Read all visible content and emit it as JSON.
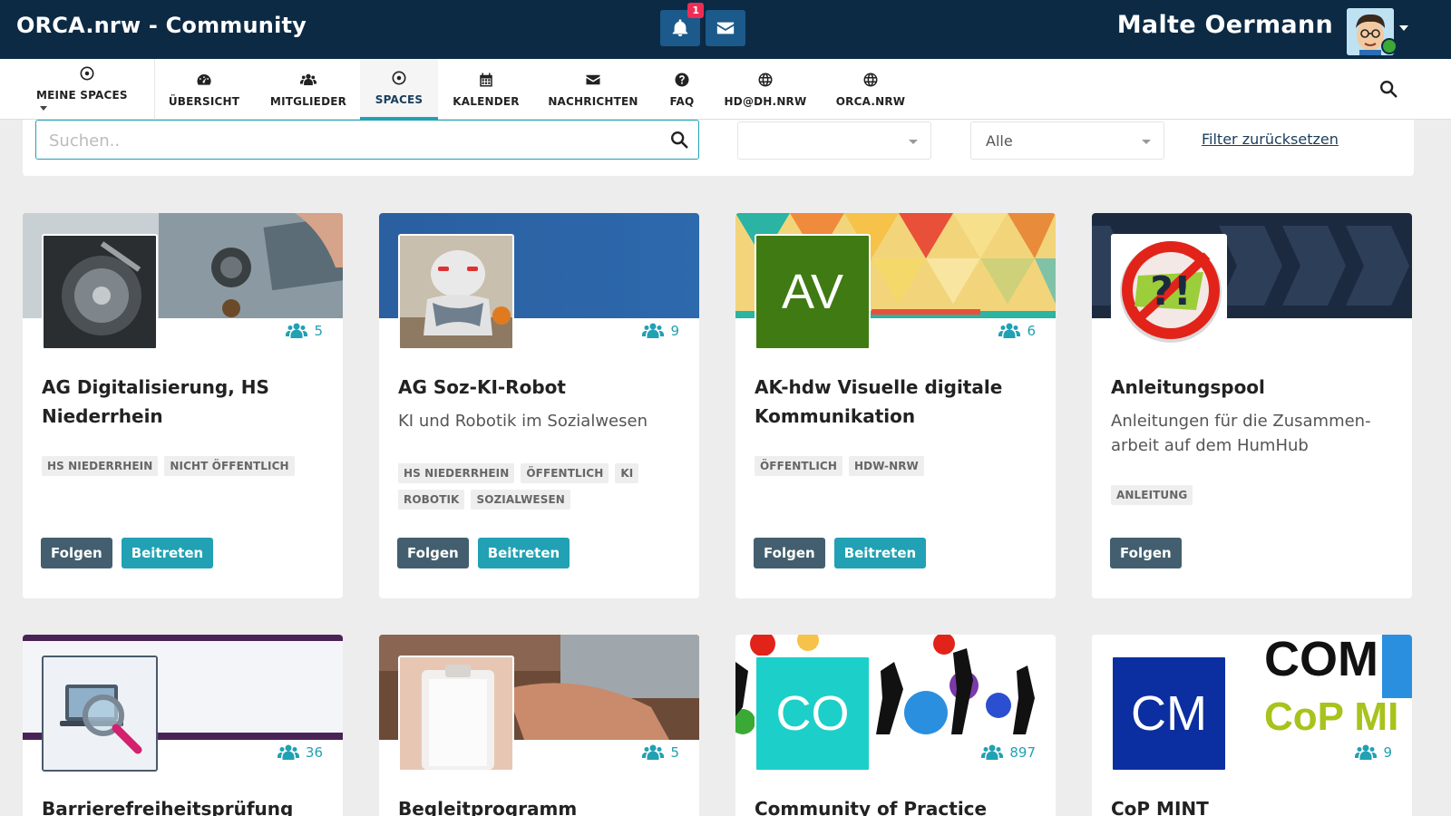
{
  "header": {
    "brand": "ORCA.nrw - Community",
    "notifications_count": "1",
    "username": "Malte Oermann"
  },
  "nav": {
    "items": [
      {
        "label": "MEINE SPACES",
        "icon": "target-icon"
      },
      {
        "label": "ÜBERSICHT",
        "icon": "dashboard-icon"
      },
      {
        "label": "MITGLIEDER",
        "icon": "users-icon"
      },
      {
        "label": "SPACES",
        "icon": "target-icon"
      },
      {
        "label": "KALENDER",
        "icon": "calendar-icon"
      },
      {
        "label": "NACHRICHTEN",
        "icon": "envelope-icon"
      },
      {
        "label": "FAQ",
        "icon": "question-icon"
      },
      {
        "label": "HD@DH.NRW",
        "icon": "globe-icon"
      },
      {
        "label": "ORCA.NRW",
        "icon": "globe-icon"
      }
    ],
    "active": "SPACES"
  },
  "filters": {
    "search_placeholder": "Suchen..",
    "select1_value": "",
    "select2_value": "Alle",
    "reset_label": "Filter zurücksetzen"
  },
  "cards": [
    {
      "title": "AG Digitalisierung, HS Niederrhein",
      "description": "",
      "members": "5",
      "tags": [
        "HS NIEDERRHEIN",
        "NICHT ÖFFENTLICH"
      ],
      "follow_label": "Folgen",
      "join_label": "Beitreten"
    },
    {
      "title": "AG Soz-KI-Robot",
      "description": "KI und Robotik im Sozialwesen",
      "members": "9",
      "tags": [
        "HS NIEDERRHEIN",
        "ÖFFENTLICH",
        "KI",
        "ROBOTIK",
        "SOZIALWESEN"
      ],
      "follow_label": "Folgen",
      "join_label": "Beitreten"
    },
    {
      "title": "AK-hdw Visuelle digitale Kommunikation",
      "description": "",
      "members": "6",
      "thumb_text": "AV",
      "thumb_color": "#3f7a12",
      "tags": [
        "ÖFFENTLICH",
        "HDW-NRW"
      ],
      "follow_label": "Folgen",
      "join_label": "Beitreten"
    },
    {
      "title": "Anleitungspool",
      "description": "Anleitungen für die Zusammen-arbeit auf dem HumHub",
      "members": "",
      "thumb_text": "?!",
      "tags": [
        "ANLEITUNG"
      ],
      "follow_label": "Folgen"
    },
    {
      "title": "Barrierefreiheitsprüfung",
      "members": "36"
    },
    {
      "title": "Begleitprogramm",
      "members": "5"
    },
    {
      "title": "Community of Practice",
      "members": "897",
      "thumb_text": "CO",
      "thumb_color": "#1ccfc9"
    },
    {
      "title": "CoP MINT",
      "members": "9",
      "thumb_text": "CM",
      "thumb_color": "#0b2fa0",
      "banner_text_1": "COM",
      "banner_text_2": "CoP MI"
    }
  ],
  "colors": {
    "topbar": "#0c2a44",
    "accent": "#21a1b3",
    "follow": "#435f6f",
    "badge": "#ef2c54"
  }
}
